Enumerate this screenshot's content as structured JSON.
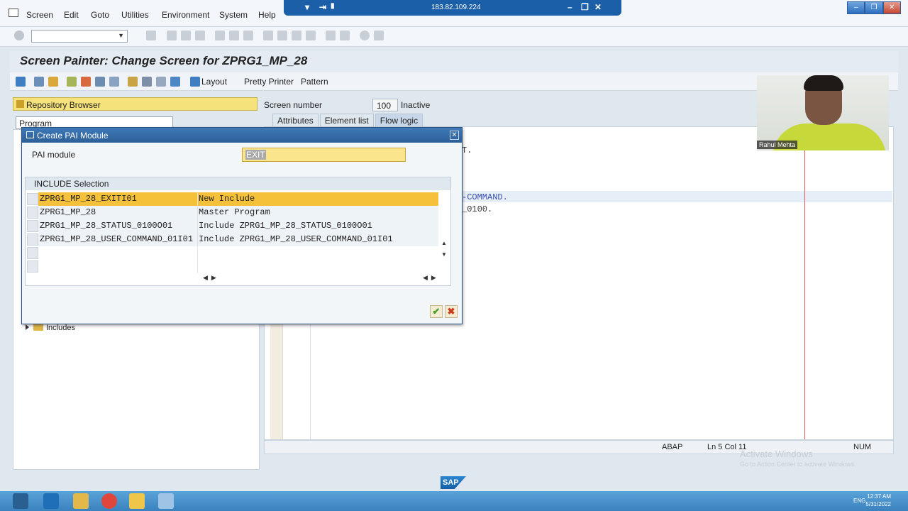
{
  "menu": {
    "items": [
      "Screen",
      "Edit",
      "Goto",
      "Utilities",
      "Environment",
      "System",
      "Help"
    ]
  },
  "remote": {
    "ip": "183.82.109.224"
  },
  "title": "Screen Painter: Change Screen for ZPRG1_MP_28",
  "app_toolbar": {
    "layout_label": "Layout",
    "pretty_printer_label": "Pretty Printer",
    "pattern_label": "Pattern"
  },
  "left": {
    "repo_browser": "Repository Browser",
    "object_type": "Program",
    "includes_label": "Includes"
  },
  "screen": {
    "number_label": "Screen number",
    "number": "100",
    "state": "Inactive",
    "tabs": [
      "Attributes",
      "Element list",
      "Flow logic"
    ]
  },
  "editor": {
    "code_1": "T.",
    "code_2": "-COMMAND.",
    "code_3": "_0100."
  },
  "status": {
    "language": "ABAP",
    "position": "Ln 5 Col 11",
    "num": "NUM"
  },
  "watermark": {
    "line1": "Activate Windows",
    "line2": "Go to Action Center to activate Windows."
  },
  "webcam": {
    "name": "Rahul Mehta"
  },
  "dialog": {
    "title": "Create PAI Module",
    "pai_label": "PAI module",
    "pai_value": "EXIT",
    "selection_header": "INCLUDE Selection",
    "rows": [
      {
        "name": "ZPRG1_MP_28_EXITI01",
        "desc": "New Include"
      },
      {
        "name": "ZPRG1_MP_28",
        "desc": "Master Program"
      },
      {
        "name": "ZPRG1_MP_28_STATUS_0100O01",
        "desc": "Include ZPRG1_MP_28_STATUS_0100O01"
      },
      {
        "name": "ZPRG1_MP_28_USER_COMMAND_01I01",
        "desc": "Include ZPRG1_MP_28_USER_COMMAND_01I01"
      }
    ]
  },
  "taskbar": {
    "time": "12:37 AM",
    "date": "5/31/2022",
    "lang": "ENG"
  },
  "colors": {
    "selected_row": "#f5c13a",
    "dialog_title": "#2c5f98",
    "input_highlight": "#fbe58c"
  }
}
